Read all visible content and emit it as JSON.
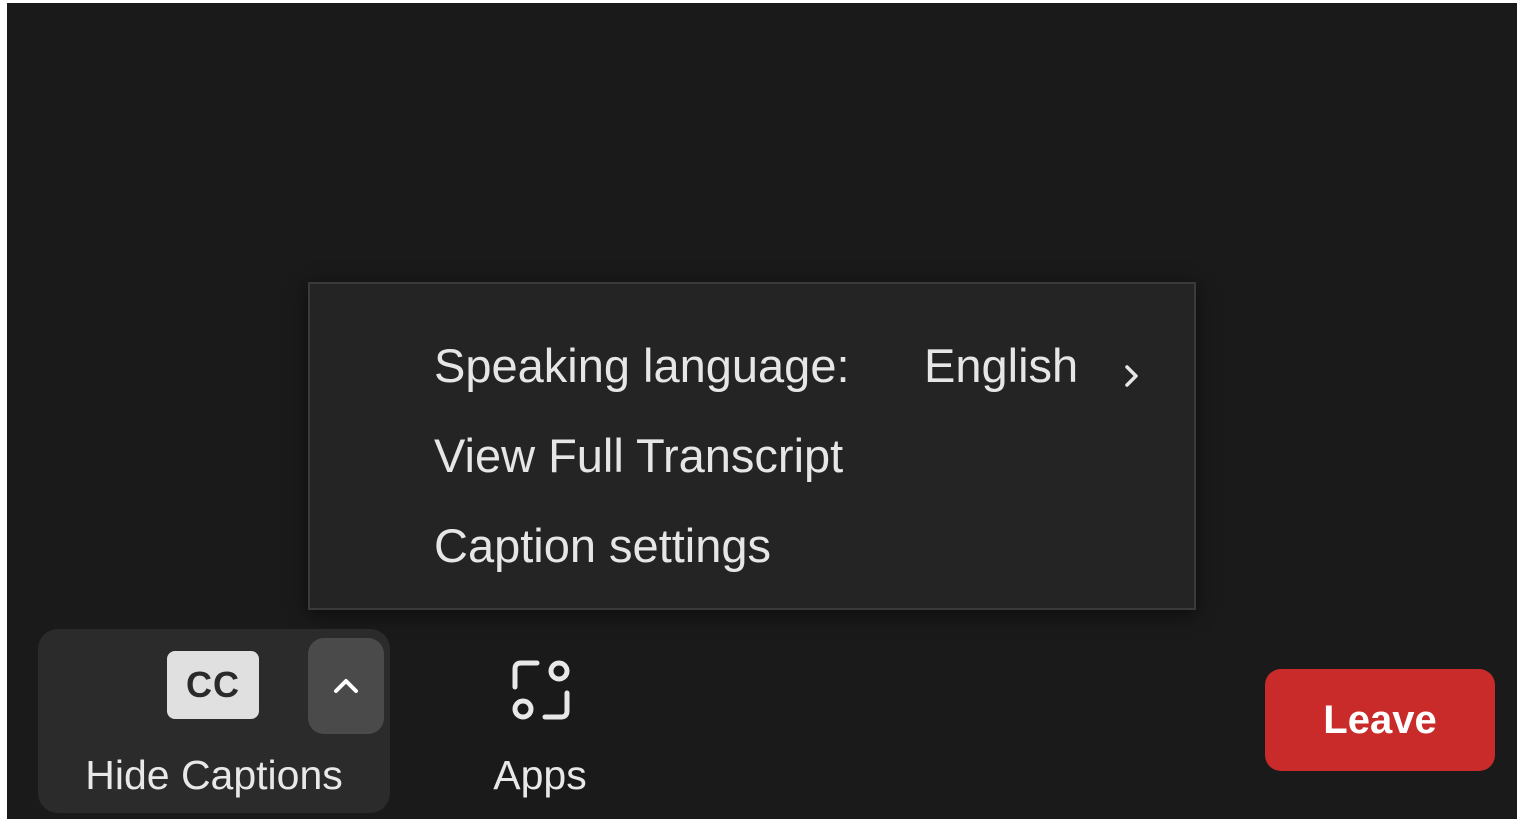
{
  "caption_menu": {
    "speaking_language_label": "Speaking language:",
    "speaking_language_value": "English",
    "view_transcript": "View Full Transcript",
    "caption_settings": "Caption settings"
  },
  "toolbar": {
    "captions_badge": "CC",
    "captions_label": "Hide Captions",
    "apps_label": "Apps",
    "leave_label": "Leave"
  },
  "icons": {
    "submenu": "chevron-right-icon",
    "captions_options": "chevron-up-icon",
    "apps": "apps-icon"
  },
  "colors": {
    "background": "#1a1a1a",
    "menu_background": "#242424",
    "leave_button": "#c92a2a"
  }
}
